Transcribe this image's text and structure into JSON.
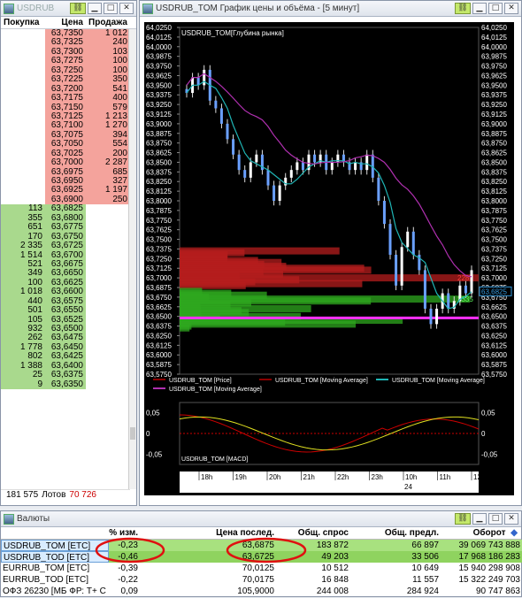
{
  "orderbook": {
    "title": "USDRUB",
    "headers": {
      "bid": "Покупка",
      "price": "Цена",
      "ask": "Продажа"
    },
    "asks": [
      {
        "price": "63,7350",
        "qty": "1 012"
      },
      {
        "price": "63,7325",
        "qty": "240"
      },
      {
        "price": "63,7300",
        "qty": "103"
      },
      {
        "price": "63,7275",
        "qty": "100"
      },
      {
        "price": "63,7250",
        "qty": "100"
      },
      {
        "price": "63,7225",
        "qty": "350"
      },
      {
        "price": "63,7200",
        "qty": "541"
      },
      {
        "price": "63,7175",
        "qty": "400"
      },
      {
        "price": "63,7150",
        "qty": "579"
      },
      {
        "price": "63,7125",
        "qty": "1 213"
      },
      {
        "price": "63,7100",
        "qty": "1 270"
      },
      {
        "price": "63,7075",
        "qty": "394"
      },
      {
        "price": "63,7050",
        "qty": "554"
      },
      {
        "price": "63,7025",
        "qty": "200"
      },
      {
        "price": "63,7000",
        "qty": "2 287"
      },
      {
        "price": "63,6975",
        "qty": "685"
      },
      {
        "price": "63,6950",
        "qty": "327"
      },
      {
        "price": "63,6925",
        "qty": "1 197"
      },
      {
        "price": "63,6900",
        "qty": "250"
      }
    ],
    "bids": [
      {
        "qty": "113",
        "price": "63,6825"
      },
      {
        "qty": "355",
        "price": "63,6800"
      },
      {
        "qty": "651",
        "price": "63,6775"
      },
      {
        "qty": "170",
        "price": "63,6750"
      },
      {
        "qty": "2 335",
        "price": "63,6725"
      },
      {
        "qty": "1 514",
        "price": "63,6700"
      },
      {
        "qty": "521",
        "price": "63,6675"
      },
      {
        "qty": "349",
        "price": "63,6650"
      },
      {
        "qty": "100",
        "price": "63,6625"
      },
      {
        "qty": "1 018",
        "price": "63,6600"
      },
      {
        "qty": "440",
        "price": "63,6575"
      },
      {
        "qty": "501",
        "price": "63,6550"
      },
      {
        "qty": "105",
        "price": "63,6525"
      },
      {
        "qty": "932",
        "price": "63,6500"
      },
      {
        "qty": "262",
        "price": "63,6475"
      },
      {
        "qty": "1 778",
        "price": "63,6450"
      },
      {
        "qty": "802",
        "price": "63,6425"
      },
      {
        "qty": "1 388",
        "price": "63,6400"
      },
      {
        "qty": "25",
        "price": "63,6375"
      },
      {
        "qty": "9",
        "price": "63,6350"
      }
    ],
    "footer": {
      "total": "181 575",
      "unit": "Лотов",
      "ask_total": "70 726"
    }
  },
  "chart": {
    "window_title": "USDRUB_TOM График цены и объёма - [5 минут]",
    "inner_label": "USDRUB_TOM[Глубина рынка]",
    "price_axis": [
      "64,0250",
      "64,0125",
      "64,0000",
      "63,9875",
      "63,9750",
      "63,9625",
      "63,9500",
      "63,9375",
      "63,9250",
      "63,9125",
      "63,9000",
      "63,8875",
      "63,8750",
      "63,8625",
      "63,8500",
      "63,8375",
      "63,8250",
      "63,8125",
      "63,8000",
      "63,7875",
      "63,7750",
      "63,7625",
      "63,7500",
      "63,7375",
      "63,7250",
      "63,7125",
      "63,7000",
      "63,6875",
      "63,6750",
      "63,6625",
      "63,6500",
      "63,6375",
      "63,6250",
      "63,6125",
      "63,6000",
      "63,5875",
      "63,5750"
    ],
    "last_price": "63,6825",
    "depth_labels": {
      "ask": "2287",
      "bid": "2335"
    },
    "legend": [
      {
        "label": "USDRUB_TOM [Price]",
        "color": "#8b0000"
      },
      {
        "label": "USDRUB_TOM [Moving Average]",
        "color": "#8b0000"
      },
      {
        "label": "USDRUB_TOM [Moving Average]",
        "color": "#1fb5b5"
      },
      {
        "label": "USDRUB_TOM [Moving Average]",
        "color": "#b030b0"
      }
    ],
    "macd_label": "USDRUB_TOM [MACD]",
    "macd_axis": [
      "0,05",
      "0",
      "-0,05"
    ],
    "time_labels": [
      "18h",
      "19h",
      "20h",
      "21h",
      "22h",
      "23h",
      "10h",
      "11h",
      "12h"
    ],
    "date_label": "24"
  },
  "table": {
    "title": "Валюты",
    "headers": [
      "",
      "% изм.",
      "Цена послед.",
      "Общ. спрос",
      "Общ. предл.",
      "Оборот"
    ],
    "rows": [
      [
        "USDRUB_TOM [ETC]",
        "-0,23",
        "63,6875",
        "183 872",
        "66 897",
        "39 069 743 888"
      ],
      [
        "USDRUB_TOD [ETC]",
        "-0,46",
        "63,6725",
        "49 203",
        "33 506",
        "17 968 186 283"
      ],
      [
        "EURRUB_TOM [ETC]",
        "-0,39",
        "70,0125",
        "10 512",
        "10 649",
        "15 940 298 908"
      ],
      [
        "EURRUB_TOD [ETC]",
        "-0,22",
        "70,0175",
        "16 848",
        "11 557",
        "15 322 249 703"
      ],
      [
        "ОФЗ 26230 [МБ ФР: Т+ С",
        "0,09",
        "105,9000",
        "244 008",
        "284 924",
        "90 747 863"
      ]
    ]
  }
}
